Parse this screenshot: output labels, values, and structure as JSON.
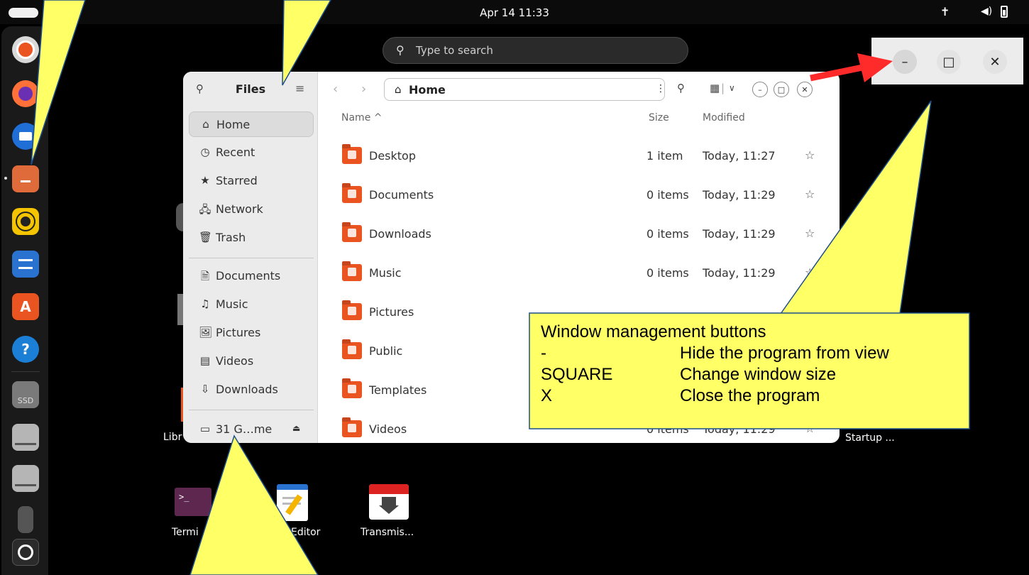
{
  "topbar": {
    "clock": "Apr 14  11:33"
  },
  "search": {
    "placeholder": "Type to search"
  },
  "dock": {
    "items": [
      "disk-usage",
      "firefox",
      "thunderbird",
      "files",
      "rhythmbox",
      "writer",
      "app-center",
      "help",
      "ssd",
      "drive-1",
      "drive-2",
      "usb",
      "show-apps"
    ],
    "ssd_label": "SSD"
  },
  "desktop": {
    "icons": [
      {
        "label": "Termi"
      },
      {
        "label": "Editor"
      },
      {
        "label": "Transmis..."
      },
      {
        "label": "Startup ..."
      },
      {
        "label": "Libr"
      }
    ]
  },
  "files": {
    "title": "Files",
    "sidebar": [
      {
        "label": "Home",
        "icon": "⌂"
      },
      {
        "label": "Recent",
        "icon": "◷"
      },
      {
        "label": "Starred",
        "icon": "★"
      },
      {
        "label": "Network",
        "icon": "🖧"
      },
      {
        "label": "Trash",
        "icon": "🗑"
      },
      {
        "label": "Documents",
        "icon": "🗎"
      },
      {
        "label": "Music",
        "icon": "♫"
      },
      {
        "label": "Pictures",
        "icon": "🖼"
      },
      {
        "label": "Videos",
        "icon": "▤"
      },
      {
        "label": "Downloads",
        "icon": "⇩"
      },
      {
        "label": "31 G…me",
        "icon": "▭"
      }
    ],
    "path": "Home",
    "columns": {
      "name": "Name",
      "size": "Size",
      "modified": "Modified"
    },
    "rows": [
      {
        "name": "Desktop",
        "size": "1 item",
        "modified": "Today, 11:27"
      },
      {
        "name": "Documents",
        "size": "0 items",
        "modified": "Today, 11:29"
      },
      {
        "name": "Downloads",
        "size": "0 items",
        "modified": "Today, 11:29"
      },
      {
        "name": "Music",
        "size": "0 items",
        "modified": "Today, 11:29"
      },
      {
        "name": "Pictures",
        "size": "",
        "modified": ""
      },
      {
        "name": "Public",
        "size": "",
        "modified": ""
      },
      {
        "name": "Templates",
        "size": "",
        "modified": ""
      },
      {
        "name": "Videos",
        "size": "0 items",
        "modified": "Today, 11:29"
      }
    ]
  },
  "callout": {
    "title": "Window management buttons",
    "lines": [
      {
        "key": "-",
        "desc": "Hide the program from view"
      },
      {
        "key": "SQUARE",
        "desc": "Change window size"
      },
      {
        "key": "X",
        "desc": "Close the program"
      }
    ]
  },
  "colors": {
    "accent": "#e95420",
    "callout": "#ffff66",
    "arrow": "#ff2a2a"
  }
}
